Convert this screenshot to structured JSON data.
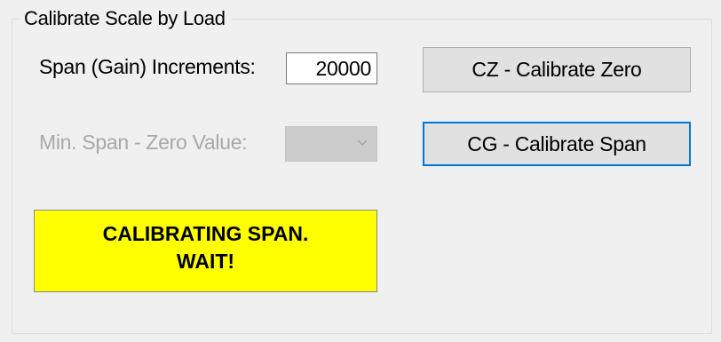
{
  "group": {
    "title": "Calibrate Scale by Load"
  },
  "span_gain": {
    "label": "Span (Gain) Increments:",
    "value": "20000"
  },
  "min_span": {
    "label": "Min. Span - Zero Value:",
    "selected": ""
  },
  "buttons": {
    "calibrate_zero": "CZ - Calibrate Zero",
    "calibrate_span": "CG - Calibrate Span"
  },
  "status": {
    "line1": "CALIBRATING SPAN.",
    "line2": "WAIT!",
    "background": "#ffff00"
  },
  "icons": {
    "combo_arrow": "chevron-down-icon"
  }
}
